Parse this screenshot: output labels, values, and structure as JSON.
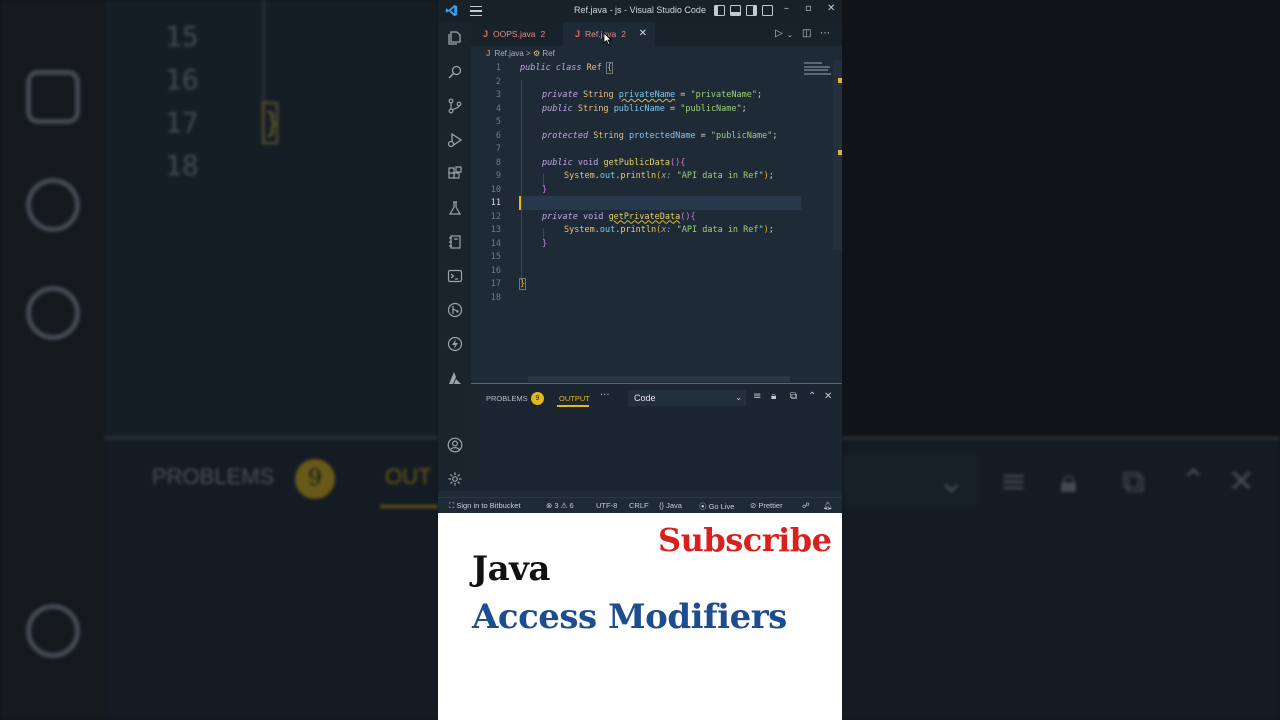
{
  "window": {
    "title": "Ref.java - js - Visual Studio Code"
  },
  "tabs": [
    {
      "icon": "J",
      "label": "OOPS.java",
      "count": "2"
    },
    {
      "icon": "J",
      "label": "Ref.java",
      "count": "2",
      "active": true
    }
  ],
  "breadcrumb": {
    "file": "Ref.java",
    "symbol": "Ref"
  },
  "editor": {
    "line_numbers": [
      "1",
      "2",
      "3",
      "4",
      "5",
      "6",
      "7",
      "8",
      "9",
      "10",
      "11",
      "12",
      "13",
      "14",
      "15",
      "16",
      "17",
      "18"
    ],
    "active_line": "11",
    "lines": {
      "l1": {
        "kw1": "public",
        "kw2": "class",
        "name": "Ref",
        "brace": "{"
      },
      "l3": {
        "kw": "private",
        "type": "String",
        "field": "privateName",
        "eq": " = ",
        "str": "\"privateName\"",
        "end": ";"
      },
      "l4": {
        "kw": "public",
        "type": "String",
        "field": "publicName",
        "eq": " = ",
        "str": "\"publicName\"",
        "end": ";"
      },
      "l6": {
        "kw": "protected",
        "type": "String",
        "field": "protectedName",
        "eq": " = ",
        "str": "\"publicName\"",
        "end": ";"
      },
      "l8": {
        "kw": "public",
        "type": "void",
        "fn": "getPublicData",
        "parens": "()",
        "brace": "{"
      },
      "l9": {
        "sys": "System",
        "dot1": ".",
        "out": "out",
        "dot2": ".",
        "fn": "println",
        "open": "(",
        "hint": "x: ",
        "str": "\"API data in Ref\"",
        "close": ")",
        "end": ";"
      },
      "l10": {
        "brace": "}"
      },
      "l12": {
        "kw": "private",
        "type": "void",
        "fn": "getPrivateData",
        "parens": "()",
        "brace": "{"
      },
      "l13": {
        "sys": "System",
        "dot1": ".",
        "out": "out",
        "dot2": ".",
        "fn": "println",
        "open": "(",
        "hint": "x: ",
        "str": "\"API data in Ref\"",
        "close": ")",
        "end": ";"
      },
      "l14": {
        "brace": "}"
      },
      "l17": {
        "brace": "}"
      }
    }
  },
  "panel": {
    "problems_label": "PROBLEMS",
    "problems_count": "9",
    "output_label": "OUTPUT",
    "more": "···",
    "channel": "Code"
  },
  "statusbar": {
    "bitbucket": "Sign in to Bitbucket",
    "errors": "3",
    "warnings": "6",
    "encoding": "UTF-8",
    "eol": "CRLF",
    "language": "Java",
    "golive": "Go Live",
    "prettier": "Prettier"
  },
  "caption": {
    "subscribe": "Subscribe",
    "title": "Java",
    "subtitle": "Access Modifiers"
  },
  "colors": {
    "accent": "#e2b81c",
    "subscribe": "#d9201c",
    "subtitle": "#1e4d8f",
    "editor_bg": "#1e2a36"
  }
}
